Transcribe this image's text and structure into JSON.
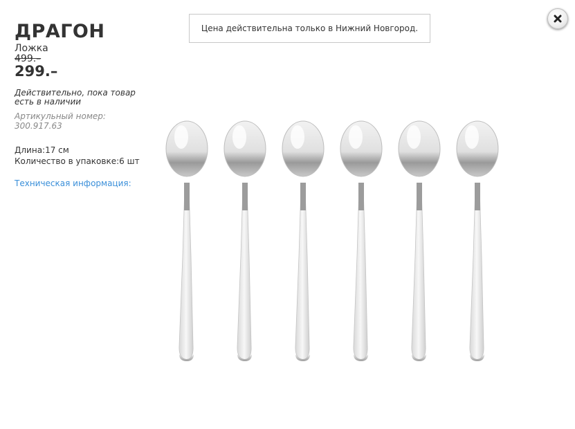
{
  "product": {
    "name": "ДРАГОН",
    "type": "Ложка",
    "old_price": "499.–",
    "price": "299.–",
    "availability": "Действительно, пока товар есть в наличии",
    "article_label": "Артикульный номер:",
    "article_number": "300.917.63",
    "specs": [
      {
        "label": "Длина:",
        "value": "17 см"
      },
      {
        "label": "Количество в упаковке:",
        "value": "6 шт"
      }
    ],
    "tech_info_link": "Техническая информация:"
  },
  "notice": "Цена действительна только в Нижний Новгород.",
  "close_icon": "close-icon",
  "image": {
    "subject": "spoons",
    "count": 6
  }
}
